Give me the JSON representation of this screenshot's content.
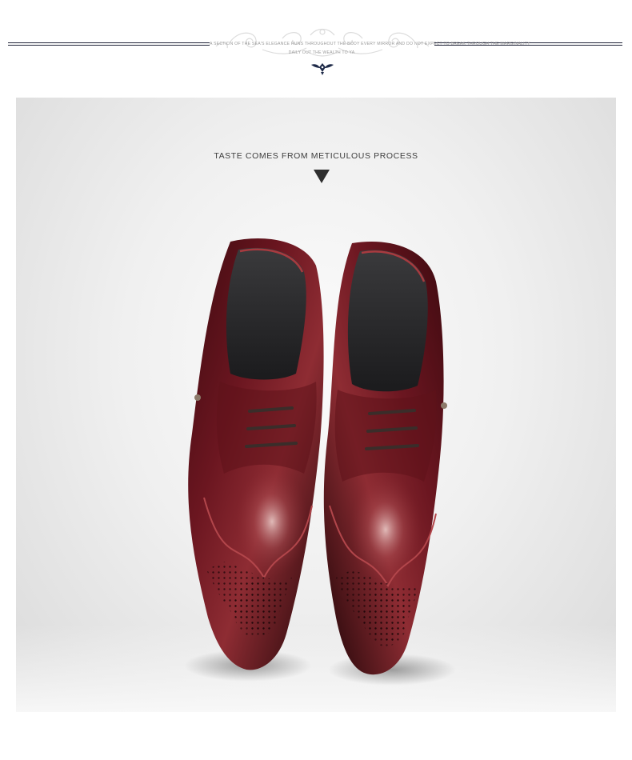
{
  "header": {
    "fine_print_line1": "A section of the sea's elegance runs throughout the body every mirror and do not expect to break through the marginality",
    "fine_print_line2": "Daily out the wealth to ya"
  },
  "product": {
    "tagline": "TASTE COMES FROM METICULOUS PROCESS",
    "image_subject": "pair of burgundy leather wingtip brogue oxford shoes"
  },
  "colors": {
    "rule": "#22253a",
    "emblem": "#1e2a48",
    "leather": "#5a0f17",
    "leather_highlight": "#8e2c33",
    "lining": "#2a2a2c",
    "background": "#ededed"
  },
  "icons": {
    "arrow": "down-triangle-icon",
    "emblem": "brand-emblem-icon"
  }
}
